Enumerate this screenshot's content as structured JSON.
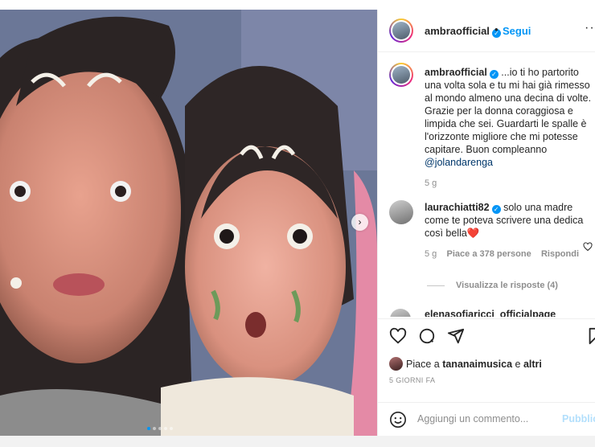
{
  "post": {
    "author": "ambraofficial",
    "follow_label": "Segui",
    "separator": "•",
    "more_glyph": "···",
    "caption": "...io ti ho partorito una volta sola e tu mi hai già rimesso al mondo almeno una decina di volte. Grazie per la donna coraggiosa e limpida che sei. Guardarti le spalle è l'orizzonte migliore che mi potesse capitare. Buon compleanno",
    "caption_mention": "@jolandarenga",
    "caption_age": "5 g",
    "carousel": {
      "slides": 5,
      "active_index": 1
    }
  },
  "comments": [
    {
      "username": "laurachiatti82",
      "text": "solo una madre come te poteva scrivere una dedica così bella",
      "emoji": "❤️",
      "age": "5 g",
      "likes_label": "Piace a 378 persone",
      "reply_label": "Rispondi",
      "view_replies": "Visualizza le risposte (4)"
    }
  ],
  "truncated_comment_user": "elenasofiaricci_officialpage",
  "likes": {
    "prefix": "Piace a",
    "user": "tananaimusica",
    "conjunction": "e",
    "others": "altri"
  },
  "timestamp": "5 GIORNI FA",
  "add_comment": {
    "placeholder": "Aggiungi un commento...",
    "publish_label": "Pubblica"
  },
  "icons": {
    "like": "heart-icon",
    "comment": "comment-icon",
    "share": "share-icon",
    "save": "bookmark-icon",
    "emoji": "emoji-icon",
    "next": "chevron-right-icon",
    "verified": "verified-badge-icon"
  },
  "colors": {
    "accent": "#0095f6",
    "text": "#262626",
    "secondary": "#8e8e8e",
    "heart": "#ed4956"
  }
}
